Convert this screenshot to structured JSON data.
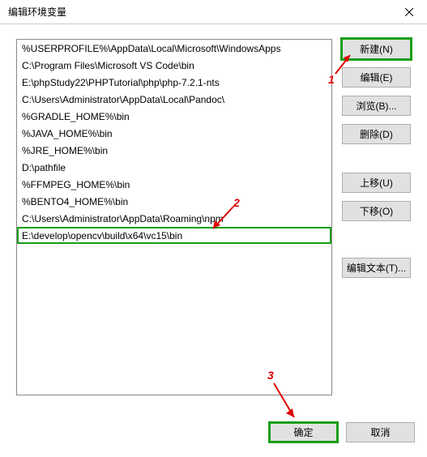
{
  "title": "编辑环境变量",
  "listItems": [
    "%USERPROFILE%\\AppData\\Local\\Microsoft\\WindowsApps",
    "C:\\Program Files\\Microsoft VS Code\\bin",
    "E:\\phpStudy22\\PHPTutorial\\php\\php-7.2.1-nts",
    "C:\\Users\\Administrator\\AppData\\Local\\Pandoc\\",
    "%GRADLE_HOME%\\bin",
    "%JAVA_HOME%\\bin",
    "%JRE_HOME%\\bin",
    "D:\\pathfile",
    "%FFMPEG_HOME%\\bin",
    "%BENTO4_HOME%\\bin",
    "C:\\Users\\Administrator\\AppData\\Roaming\\npm",
    "E:\\develop\\opencv\\build\\x64\\vc15\\bin"
  ],
  "selectedIndex": 11,
  "buttons": {
    "new": "新建(N)",
    "edit": "编辑(E)",
    "browse": "浏览(B)...",
    "delete": "删除(D)",
    "moveUp": "上移(U)",
    "moveDown": "下移(O)",
    "editText": "编辑文本(T)...",
    "ok": "确定",
    "cancel": "取消"
  },
  "annotations": {
    "n1": "1",
    "n2": "2",
    "n3": "3"
  }
}
